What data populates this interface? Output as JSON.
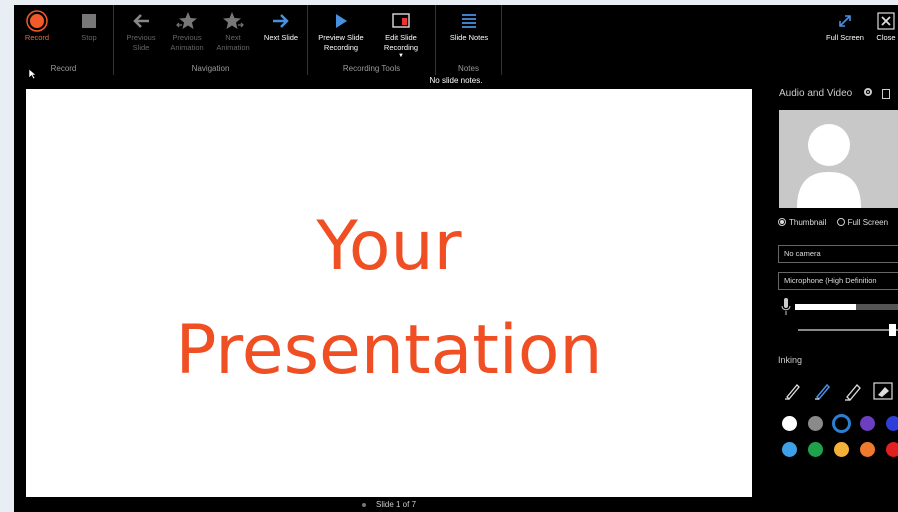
{
  "ribbon": {
    "record": {
      "buttons": [
        {
          "label": "Record"
        },
        {
          "label": "Stop"
        }
      ],
      "group_label": "Record"
    },
    "navigation": {
      "buttons": [
        {
          "label": "Previous Slide"
        },
        {
          "label": "Previous Animation"
        },
        {
          "label": "Next Animation"
        },
        {
          "label": "Next Slide"
        }
      ],
      "group_label": "Navigation"
    },
    "recording_tools": {
      "buttons": [
        {
          "label": "Preview Slide Recording"
        },
        {
          "label": "Edit Slide Recording"
        }
      ],
      "group_label": "Recording Tools"
    },
    "notes": {
      "buttons": [
        {
          "label": "Slide Notes"
        }
      ],
      "group_label": "Notes"
    },
    "view": {
      "buttons": [
        {
          "label": "Full Screen"
        },
        {
          "label": "Close"
        }
      ]
    }
  },
  "notes_bar": "No slide notes.",
  "slide": {
    "line1": "Your",
    "line2": "Presentation",
    "title_color": "#f04e23",
    "status": "Slide 1 of 7"
  },
  "panel": {
    "title": "Audio and Video",
    "view_options": [
      {
        "label": "Thumbnail",
        "selected": true
      },
      {
        "label": "Full Screen",
        "selected": false
      }
    ],
    "camera": "No camera",
    "microphone": "Microphone (High Definition",
    "mic_level": 0.55,
    "slider_value": 0.85,
    "inking_label": "Inking",
    "inking_tools": [
      "pen-icon",
      "pen-icon",
      "highlighter-icon",
      "eraser-icon"
    ],
    "colors": [
      "#ffffff",
      "#8a8a8a",
      "#2a7fd0",
      "#6b3fbf",
      "#2d3fd8",
      "#3ea0e6",
      "#1ea34a",
      "#f2b23a",
      "#f07a2e",
      "#e22020"
    ]
  }
}
